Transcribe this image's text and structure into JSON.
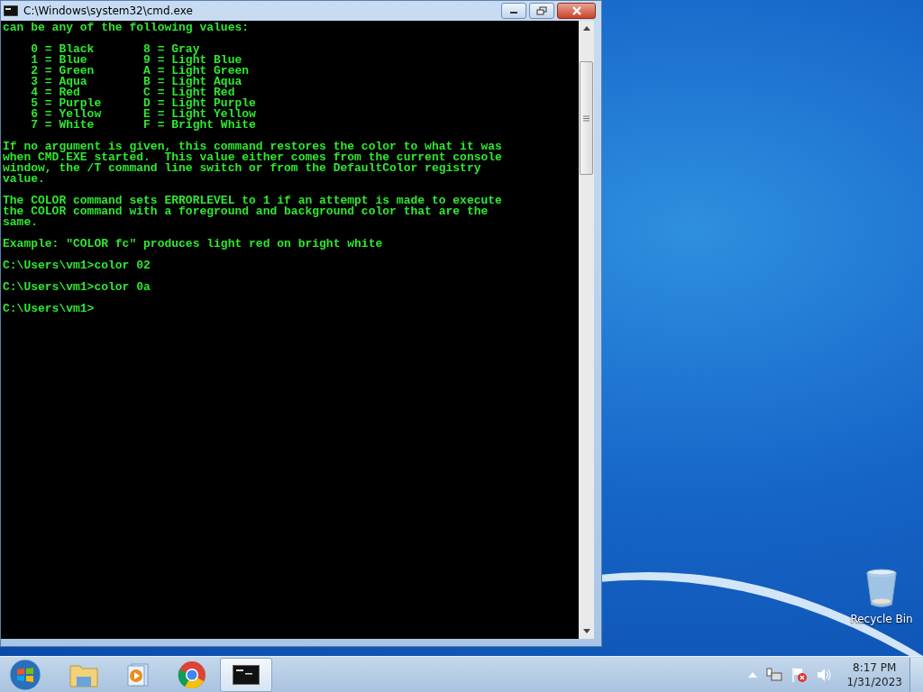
{
  "window": {
    "title": "C:\\Windows\\system32\\cmd.exe"
  },
  "console": {
    "blocks": [
      [
        "can be any of the following values:"
      ],
      [
        "    0 = Black       8 = Gray",
        "    1 = Blue        9 = Light Blue",
        "    2 = Green       A = Light Green",
        "    3 = Aqua        B = Light Aqua",
        "    4 = Red         C = Light Red",
        "    5 = Purple      D = Light Purple",
        "    6 = Yellow      E = Light Yellow",
        "    7 = White       F = Bright White"
      ],
      [
        "If no argument is given, this command restores the color to what it was",
        "when CMD.EXE started.  This value either comes from the current console",
        "window, the /T command line switch or from the DefaultColor registry",
        "value."
      ],
      [
        "The COLOR command sets ERRORLEVEL to 1 if an attempt is made to execute",
        "the COLOR command with a foreground and background color that are the",
        "same."
      ],
      [
        "Example: \"COLOR fc\" produces light red on bright white"
      ],
      [
        "C:\\Users\\vm1>color 02"
      ],
      [
        "C:\\Users\\vm1>color 0a"
      ],
      [
        "C:\\Users\\vm1>"
      ]
    ]
  },
  "desktop": {
    "icons": [
      {
        "label": "Recycle Bin"
      }
    ]
  },
  "taskbar": {
    "buttons": [
      {
        "kind": "start",
        "selected": false
      },
      {
        "kind": "explorer",
        "selected": false
      },
      {
        "kind": "media",
        "selected": false
      },
      {
        "kind": "browser",
        "selected": false
      },
      {
        "kind": "console",
        "selected": true
      }
    ],
    "clock": {
      "time": "8:17 PM",
      "date": "1/31/2023"
    }
  }
}
